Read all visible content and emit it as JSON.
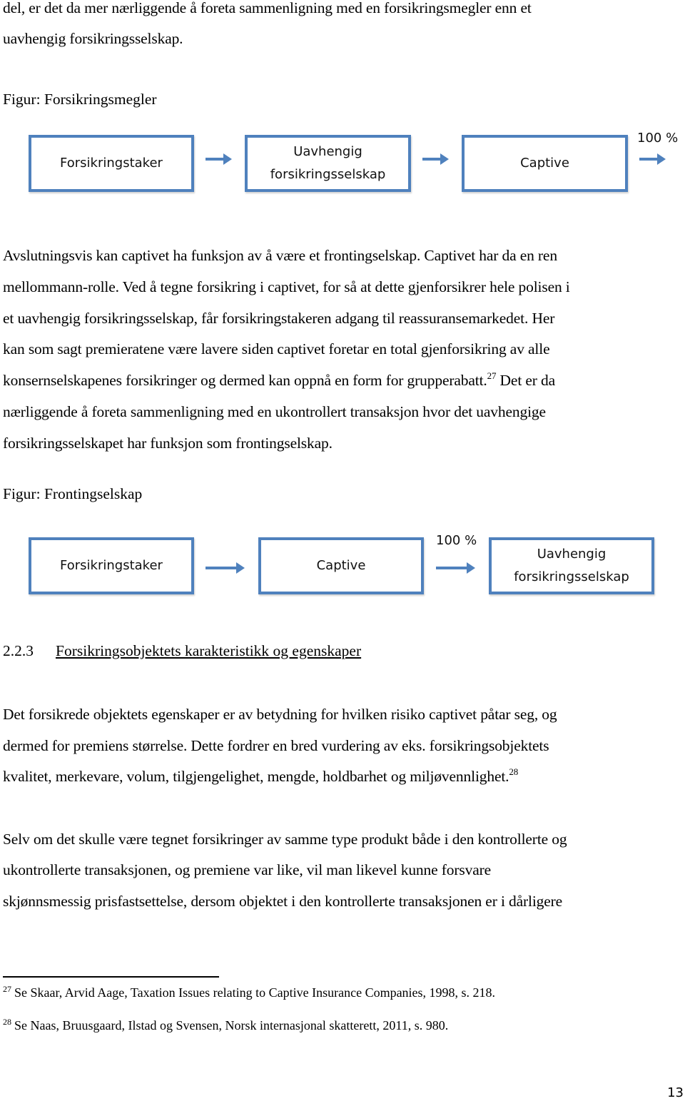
{
  "top_paragraph": {
    "lines": [
      "del, er det da mer nærliggende å foreta sammenligning med en forsikringsmegler enn et",
      "uavhengig forsikringsselskap."
    ]
  },
  "figure1": {
    "caption": "Figur: Forsikringsmegler",
    "boxes": [
      {
        "lines": [
          "Forsikringstaker"
        ]
      },
      {
        "lines": [
          "Uavhengig",
          "forsikringsselskap"
        ]
      },
      {
        "lines": [
          "Captive"
        ]
      }
    ],
    "percent_label": "100 %",
    "box_color": "#4f81bd"
  },
  "paragraph2": {
    "lines": [
      "Avslutningsvis kan captivet ha funksjon av å være et frontingselskap. Captivet har da en ren",
      "mellommann-rolle. Ved å tegne forsikring i captivet, for så at dette gjenforsikrer hele polisen i",
      "et uavhengig forsikringsselskap, får forsikringstakeren adgang til reassuransemarkedet. Her",
      "kan som sagt premieratene være lavere siden captivet foretar en total gjenforsikring av alle",
      "konsernselskapenes forsikringer og dermed kan oppnå en form for grupperabatt.",
      "nærliggende å foreta sammenligning med en ukontrollert transaksjon hvor det uavhengige",
      "forsikringsselskapet har funksjon som frontingselskap."
    ],
    "footnote_ref": "27",
    "line5_after": " Det er da"
  },
  "figure2": {
    "caption": "Figur: Frontingselskap",
    "boxes": [
      {
        "lines": [
          "Forsikringstaker"
        ]
      },
      {
        "lines": [
          "Captive"
        ]
      },
      {
        "lines": [
          "Uavhengig",
          "forsikringsselskap"
        ]
      }
    ],
    "percent_label": "100 %",
    "box_color": "#4f81bd"
  },
  "section": {
    "number": "2.2.3",
    "title": "Forsikringsobjektets karakteristikk og egenskaper"
  },
  "paragraph3": {
    "lines": [
      "Det forsikrede objektets egenskaper er av betydning for hvilken risiko captivet påtar seg, og",
      "dermed for premiens størrelse. Dette fordrer en bred vurdering av eks. forsikringsobjektets",
      "kvalitet, merkevare, volum, tilgjengelighet, mengde, holdbarhet og miljøvennlighet."
    ],
    "footnote_ref": "28"
  },
  "paragraph4": {
    "lines": [
      "Selv om det skulle være tegnet forsikringer av samme type produkt både i den kontrollerte og",
      "ukontrollerte transaksjonen, og premiene var like, vil man likevel kunne forsvare",
      "skjønnsmessig prisfastsettelse, dersom objektet i den kontrollerte transaksjonen er i dårligere"
    ]
  },
  "footnotes": [
    {
      "number": "27",
      "text": "Se Skaar, Arvid Aage, Taxation Issues relating to Captive Insurance Companies, 1998, s. 218."
    },
    {
      "number": "28",
      "text": "Se Naas, Bruusgaard, Ilstad og Svensen, Norsk internasjonal skatterett, 2011, s. 980."
    }
  ],
  "page_number": "13"
}
